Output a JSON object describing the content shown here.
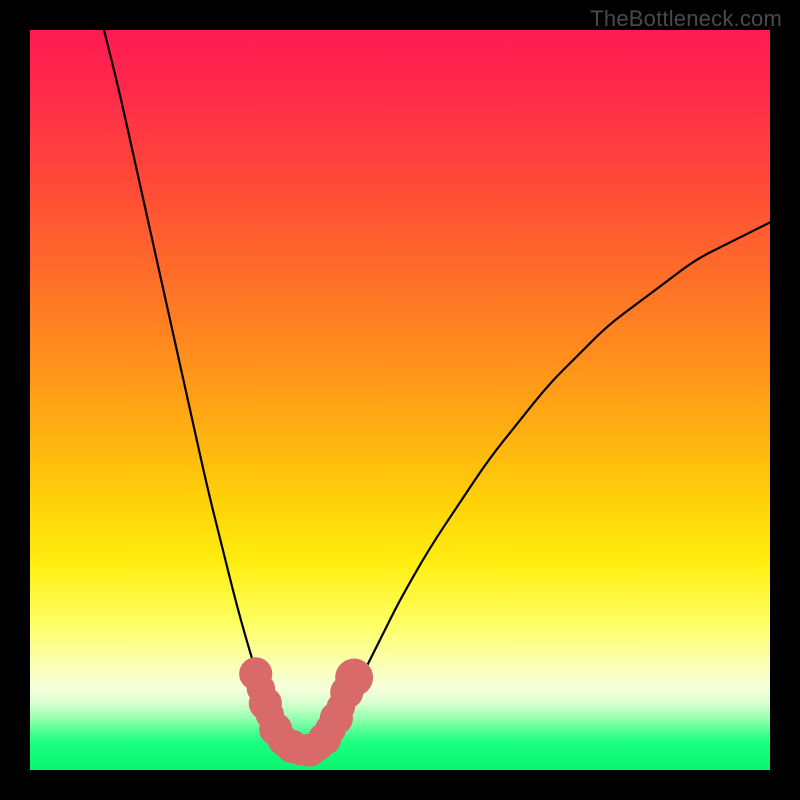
{
  "watermark": "TheBottleneck.com",
  "chart_data": {
    "type": "line",
    "title": "",
    "xlabel": "",
    "ylabel": "",
    "xlim": [
      0,
      100
    ],
    "ylim": [
      0,
      100
    ],
    "grid": false,
    "legend": false,
    "series": [
      {
        "name": "left-curve",
        "x": [
          10,
          12,
          14,
          16,
          18,
          20,
          22,
          24,
          26,
          28,
          30,
          31,
          32,
          33,
          34
        ],
        "values": [
          100,
          92,
          83,
          74,
          65,
          56,
          47,
          38,
          30,
          22,
          15,
          12,
          9,
          6,
          4
        ]
      },
      {
        "name": "right-curve",
        "x": [
          40,
          42,
          44,
          46,
          48,
          50,
          54,
          58,
          62,
          66,
          70,
          74,
          78,
          82,
          86,
          90,
          94,
          98,
          100
        ],
        "values": [
          4,
          7,
          11,
          15,
          19,
          23,
          30,
          36,
          42,
          47,
          52,
          56,
          60,
          63,
          66,
          69,
          71,
          73,
          74
        ]
      },
      {
        "name": "valley-floor",
        "x": [
          34,
          35,
          36,
          37,
          38,
          39,
          40
        ],
        "values": [
          4,
          3,
          2.5,
          2.5,
          2.5,
          3,
          4
        ]
      }
    ],
    "markers": [
      {
        "x": 30.5,
        "y": 13,
        "r": 1.4
      },
      {
        "x": 31.2,
        "y": 11,
        "r": 1.2
      },
      {
        "x": 31.8,
        "y": 9,
        "r": 1.4
      },
      {
        "x": 32.4,
        "y": 7.5,
        "r": 1.2
      },
      {
        "x": 33.2,
        "y": 5.5,
        "r": 1.4
      },
      {
        "x": 34.2,
        "y": 4.0,
        "r": 1.3
      },
      {
        "x": 35.4,
        "y": 3.2,
        "r": 1.4
      },
      {
        "x": 36.6,
        "y": 2.7,
        "r": 1.3
      },
      {
        "x": 37.8,
        "y": 2.7,
        "r": 1.4
      },
      {
        "x": 38.8,
        "y": 3.2,
        "r": 1.3
      },
      {
        "x": 39.8,
        "y": 4.2,
        "r": 1.4
      },
      {
        "x": 40.6,
        "y": 5.5,
        "r": 1.3
      },
      {
        "x": 41.4,
        "y": 7.0,
        "r": 1.4
      },
      {
        "x": 42.0,
        "y": 8.5,
        "r": 1.2
      },
      {
        "x": 42.8,
        "y": 10.5,
        "r": 1.4
      },
      {
        "x": 43.8,
        "y": 12.5,
        "r": 1.6
      }
    ],
    "background_gradient": {
      "top": "#ff1a52",
      "mid": "#ffd208",
      "bottom": "#0af573"
    }
  }
}
